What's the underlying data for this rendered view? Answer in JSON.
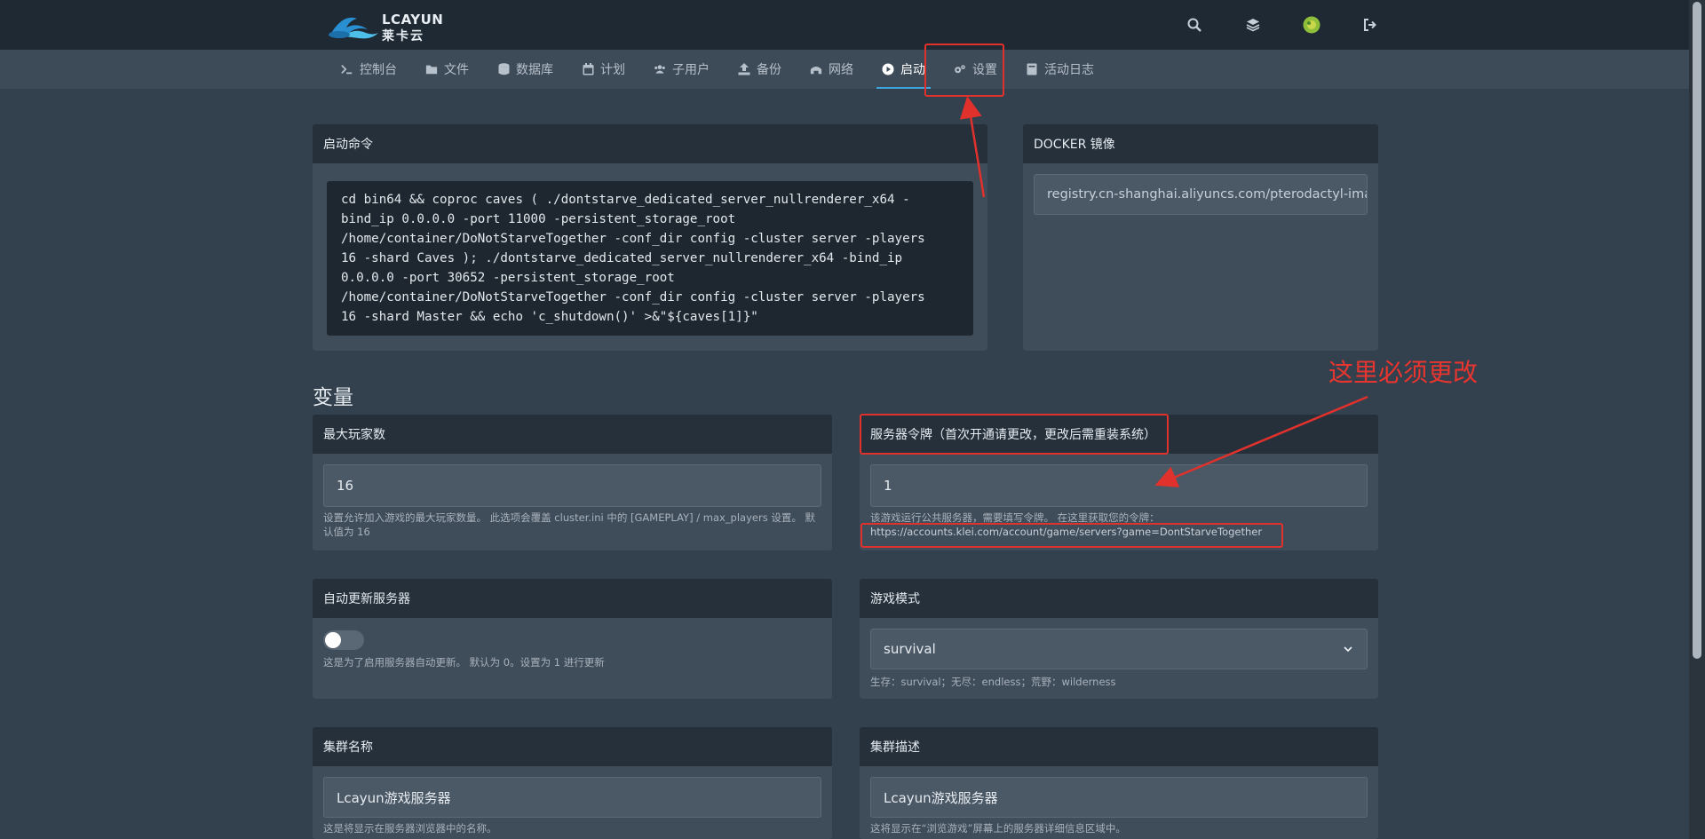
{
  "app": {
    "logo_text": "LCAYUN",
    "logo_sub": "莱卡云"
  },
  "topbar_icons": [
    "search-icon",
    "layers-icon",
    "avatar",
    "logout-icon"
  ],
  "nav": {
    "items": [
      {
        "label": "控制台",
        "icon": "terminal-icon"
      },
      {
        "label": "文件",
        "icon": "folder-icon"
      },
      {
        "label": "数据库",
        "icon": "database-icon"
      },
      {
        "label": "计划",
        "icon": "calendar-icon"
      },
      {
        "label": "子用户",
        "icon": "users-icon"
      },
      {
        "label": "备份",
        "icon": "upload-icon"
      },
      {
        "label": "网络",
        "icon": "network-icon"
      },
      {
        "label": "启动",
        "icon": "play-icon",
        "active": true
      },
      {
        "label": "设置",
        "icon": "gears-icon"
      },
      {
        "label": "活动日志",
        "icon": "book-icon"
      }
    ]
  },
  "startup": {
    "title": "启动命令",
    "command": "cd bin64 && coproc caves ( ./dontstarve_dedicated_server_nullrenderer_x64 -\nbind_ip 0.0.0.0 -port 11000 -persistent_storage_root\n/home/container/DoNotStarveTogether -conf_dir config -cluster server -players\n16 -shard Caves ); ./dontstarve_dedicated_server_nullrenderer_x64 -bind_ip\n0.0.0.0 -port 30652 -persistent_storage_root\n/home/container/DoNotStarveTogether -conf_dir config -cluster server -players\n16 -shard Master && echo 'c_shutdown()' >&\"${caves[1]}\""
  },
  "docker": {
    "title": "DOCKER 镜像",
    "value": "registry.cn-shanghai.aliyuncs.com/pterodactyl-image"
  },
  "variables_title": "变量",
  "vars": {
    "max_players": {
      "title": "最大玩家数",
      "value": "16",
      "help": "设置允许加入游戏的最大玩家数量。 此选项会覆盖 cluster.ini 中的 [GAMEPLAY] / max_players 设置。 默认值为 16"
    },
    "server_token": {
      "title": "服务器令牌（首次开通请更改，更改后需重装系统）",
      "value": "1",
      "help": "该游戏运行公共服务器，需要填写令牌。 在这里获取您的令牌：",
      "link": "https://accounts.klei.com/account/game/servers?game=DontStarveTogether"
    },
    "auto_update": {
      "title": "自动更新服务器",
      "enabled": false,
      "help": "这是为了启用服务器自动更新。 默认为 0。设置为 1 进行更新"
    },
    "game_mode": {
      "title": "游戏模式",
      "value": "survival",
      "help": "生存：survival；无尽：endless；荒野：wilderness"
    },
    "cluster_name": {
      "title": "集群名称",
      "value": "Lcayun游戏服务器",
      "help": "这是将显示在服务器浏览器中的名称。"
    },
    "cluster_desc": {
      "title": "集群描述",
      "value": "Lcayun游戏服务器",
      "help": "这将显示在“浏览游戏”屏幕上的服务器详细信息区域中。"
    }
  },
  "annotation": {
    "text": "这里必须更改",
    "color": "#e0312c"
  }
}
